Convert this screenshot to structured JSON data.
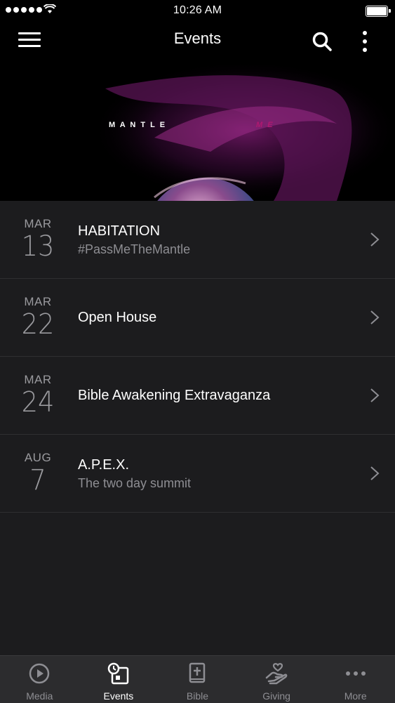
{
  "status_bar": {
    "time": "10:26 AM"
  },
  "nav": {
    "title": "Events"
  },
  "banner": {
    "text_main": "M A N T L E",
    "text_accent": "M E"
  },
  "events": [
    {
      "month": "MAR",
      "day": "13",
      "title": "HABITATION",
      "subtitle": "#PassMeTheMantle"
    },
    {
      "month": "MAR",
      "day": "22",
      "title": "Open House",
      "subtitle": ""
    },
    {
      "month": "MAR",
      "day": "24",
      "title": "Bible Awakening Extravaganza",
      "subtitle": ""
    },
    {
      "month": "AUG",
      "day": "7",
      "title": "A.P.E.X.",
      "subtitle": "The two day summit"
    }
  ],
  "tabs": [
    {
      "label": "Media",
      "icon": "play-circle-icon",
      "active": false
    },
    {
      "label": "Events",
      "icon": "calendar-clock-icon",
      "active": true
    },
    {
      "label": "Bible",
      "icon": "bible-icon",
      "active": false
    },
    {
      "label": "Giving",
      "icon": "giving-hand-icon",
      "active": false
    },
    {
      "label": "More",
      "icon": "more-dots-icon",
      "active": false
    }
  ],
  "colors": {
    "background": "#1c1c1e",
    "tab_bar": "#2c2c2e",
    "secondary_text": "#8e8e93",
    "accent_magenta": "#c0167a"
  }
}
